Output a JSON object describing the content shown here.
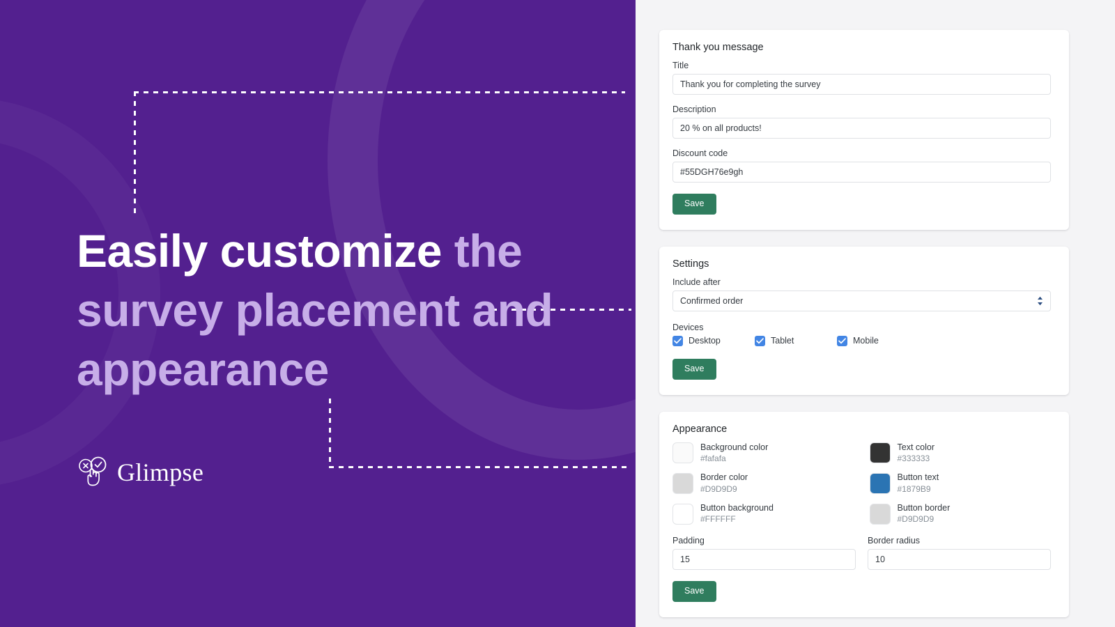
{
  "hero": {
    "headline_strong": "Easily customize",
    "headline_rest": " the survey placement and appearance",
    "brand_name": "Glimpse",
    "logo_icon": "hand-pointer-approve-reject-icon"
  },
  "thank_you_card": {
    "title": "Thank you message",
    "fields": [
      {
        "label": "Title",
        "value": "Thank you for completing the survey"
      },
      {
        "label": "Description",
        "value": "20 % on all products!"
      },
      {
        "label": "Discount code",
        "value": "#55DGH76e9gh"
      }
    ],
    "save_label": "Save"
  },
  "settings_card": {
    "title": "Settings",
    "include_after_label": "Include after",
    "include_after_value": "Confirmed order",
    "select_icon": "chevron-updown-icon",
    "devices_label": "Devices",
    "devices": [
      {
        "label": "Desktop",
        "checked": true
      },
      {
        "label": "Tablet",
        "checked": true
      },
      {
        "label": "Mobile",
        "checked": true
      }
    ],
    "save_label": "Save"
  },
  "appearance_card": {
    "title": "Appearance",
    "colors": [
      {
        "name": "Background color",
        "hex": "#fafafa",
        "swatch": "#fafafa"
      },
      {
        "name": "Text color",
        "hex": "#333333",
        "swatch": "#333333"
      },
      {
        "name": "Border color",
        "hex": "#D9D9D9",
        "swatch": "#D9D9D9"
      },
      {
        "name": "Button text",
        "hex": "#1879B9",
        "swatch": "#2b74b3"
      },
      {
        "name": "Button background",
        "hex": "#FFFFFF",
        "swatch": "#FFFFFF"
      },
      {
        "name": "Button border",
        "hex": "#D9D9D9",
        "swatch": "#D9D9D9"
      }
    ],
    "padding_label": "Padding",
    "padding_value": "15",
    "radius_label": "Border radius",
    "radius_value": "10",
    "save_label": "Save"
  },
  "theme": {
    "hero_purple": "#53208f",
    "headline_accent": "#c7aee8",
    "save_green": "#2f7d5e",
    "checkbox_blue": "#4285e4",
    "panel_bg": "#f4f4f6"
  }
}
